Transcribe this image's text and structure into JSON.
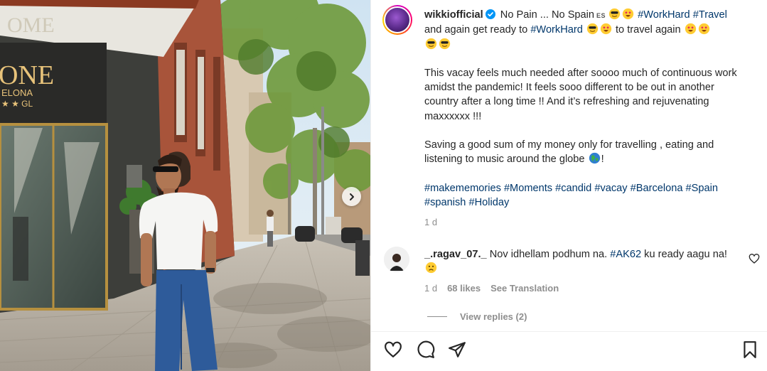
{
  "post": {
    "username": "wikkiofficial",
    "caption_line1_a": "No Pain ... No Spain",
    "flag_code": "ES",
    "tag_workhard": "#WorkHard",
    "tag_travel": "#Travel",
    "caption_line2_a": "and again get ready to",
    "caption_line2_b": "to travel again",
    "para2": "This vacay feels much needed after soooo much of continuous work amidst the pandemic! It feels sooo different to be out in another country after a long time !! And it’s refreshing and rejuvenating maxxxxxx !!!",
    "para3_a": "Saving a good sum of my money only for travelling , eating and listening to music around the globe",
    "para3_b": "!",
    "hashtags": [
      "#makememories",
      "#Moments",
      "#candid",
      "#vacay",
      "#Barcelona",
      "#Spain",
      "#spanish",
      "#Holiday"
    ],
    "time": "1 d"
  },
  "photo": {
    "sign_top": "OME",
    "sign_main": "ONE",
    "sign_sub": "ELONA",
    "sign_stars": "★ ★ GL"
  },
  "comment": {
    "username": "_.ragav_07._",
    "text_a": "Nov idhellam podhum na.",
    "tag": "#AK62",
    "text_b": "ku ready aagu na!",
    "time": "1 d",
    "likes": "68 likes",
    "see_translation": "See Translation",
    "view_replies": "View replies (2)"
  },
  "colors": {
    "link": "#00376b",
    "muted": "#8e8e8e",
    "text": "#262626",
    "verified": "#0095f6"
  },
  "icons": [
    "verified-badge-icon",
    "next-arrow-icon",
    "heart-icon",
    "comment-icon",
    "share-icon",
    "bookmark-icon"
  ]
}
